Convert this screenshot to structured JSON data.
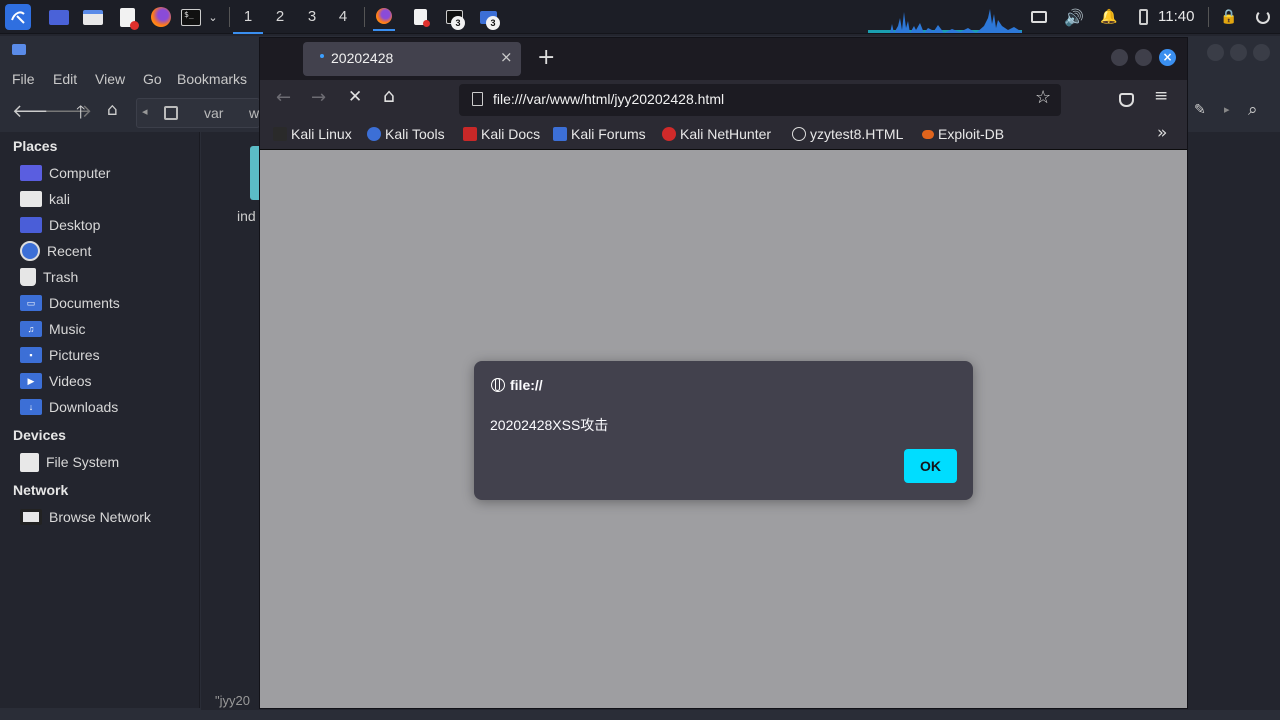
{
  "panel": {
    "workspaces": [
      "1",
      "2",
      "3",
      "4"
    ],
    "terminal_badge": "3",
    "files_badge": "3",
    "clock": "11:40"
  },
  "file_manager": {
    "menu": [
      "File",
      "Edit",
      "View",
      "Go",
      "Bookmarks"
    ],
    "path_segments": [
      "var",
      "w"
    ],
    "places_heading": "Places",
    "places": [
      "Computer",
      "kali",
      "Desktop",
      "Recent",
      "Trash",
      "Documents",
      "Music",
      "Pictures",
      "Videos",
      "Downloads"
    ],
    "devices_heading": "Devices",
    "devices": [
      "File System"
    ],
    "network_heading": "Network",
    "network": [
      "Browse Network"
    ],
    "file_label": "ind",
    "status": "\"jyy20"
  },
  "browser": {
    "tab_title": "20202428",
    "url": "file:///var/www/html/jyy20202428.html",
    "bookmarks": [
      "Kali Linux",
      "Kali Tools",
      "Kali Docs",
      "Kali Forums",
      "Kali NetHunter",
      "yzytest8.HTML",
      "Exploit-DB"
    ]
  },
  "dialog": {
    "origin": "file://",
    "message": "20202428XSS攻击",
    "ok_label": "OK"
  },
  "colors": {
    "accent": "#00ddff",
    "folder": "#3c6fd6",
    "workspace_active": "#3a8ff0"
  }
}
